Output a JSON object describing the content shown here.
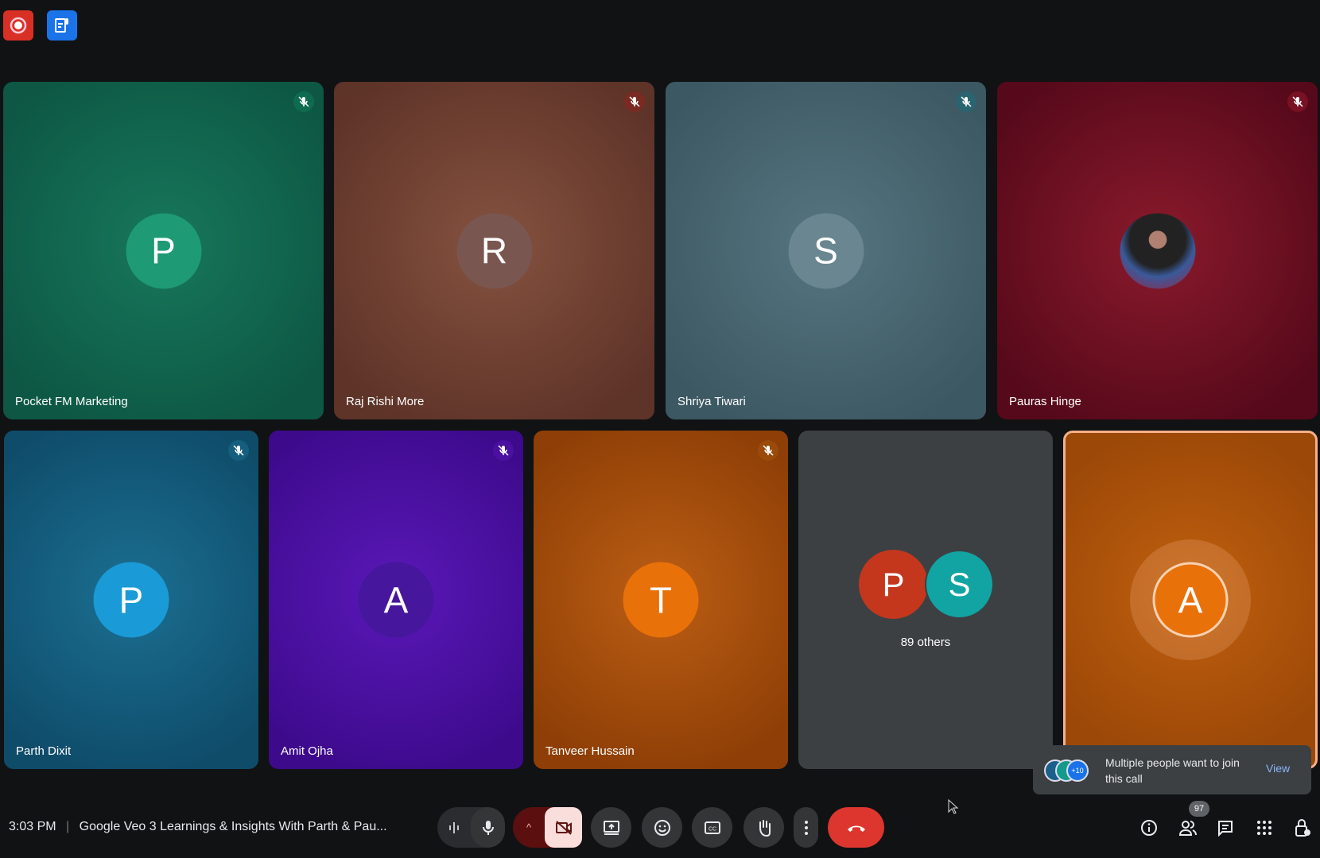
{
  "top_icons": [
    {
      "icon": "record-icon",
      "color": "#d93025"
    },
    {
      "icon": "transcript-icon",
      "color": "#1a73e8"
    }
  ],
  "row1": [
    {
      "name": "Pocket FM Marketing",
      "initial": "P",
      "bg": "#17775b",
      "edge": "#0d5744",
      "avatar": "#1e9a74",
      "muteBg": "#0f6b50"
    },
    {
      "name": "Raj Rishi More",
      "initial": "R",
      "bg": "#85523f",
      "edge": "#5e3328",
      "avatar": "#7a5650",
      "muteBg": "#7a2a22"
    },
    {
      "name": "Shriya Tiwari",
      "initial": "S",
      "bg": "#567580",
      "edge": "#3c5862",
      "avatar": "#6a8690",
      "muteBg": "#2a6470"
    },
    {
      "name": "Pauras Hinge",
      "initial": "",
      "bg": "#8a1a2c",
      "edge": "#55091a",
      "avatar": "#2a2a3a",
      "muteBg": "#7a1024"
    }
  ],
  "row2": [
    {
      "name": "Parth Dixit",
      "initial": "P",
      "bg": "#1b6f92",
      "edge": "#0f4c6a",
      "avatar": "#1a9ad6",
      "muteBg": "#155e7e"
    },
    {
      "name": "Amit Ojha",
      "initial": "A",
      "bg": "#5a18b8",
      "edge": "#3d0a8c",
      "avatar": "#46169c",
      "muteBg": "#4a10a0"
    },
    {
      "name": "Tanveer Hussain",
      "initial": "T",
      "bg": "#bb5e14",
      "edge": "#8e3e06",
      "avatar": "#e8710a",
      "muteBg": "#9a4a0a"
    }
  ],
  "others": {
    "label": "89 others",
    "avatars": [
      {
        "initial": "P",
        "color": "#c4371c"
      },
      {
        "initial": "S",
        "color": "#12a3a3"
      }
    ]
  },
  "self": {
    "initial": "A",
    "bg": "#b0550d",
    "border": "#f4b08a",
    "avatar": "#e8710a"
  },
  "notification": {
    "text": "Multiple people want to join this call",
    "action": "View",
    "more": "+10"
  },
  "bottom": {
    "time": "3:03 PM",
    "separator": "|",
    "meeting_title": "Google Veo 3 Learnings & Insights With Parth & Pau...",
    "people_count": "97"
  }
}
